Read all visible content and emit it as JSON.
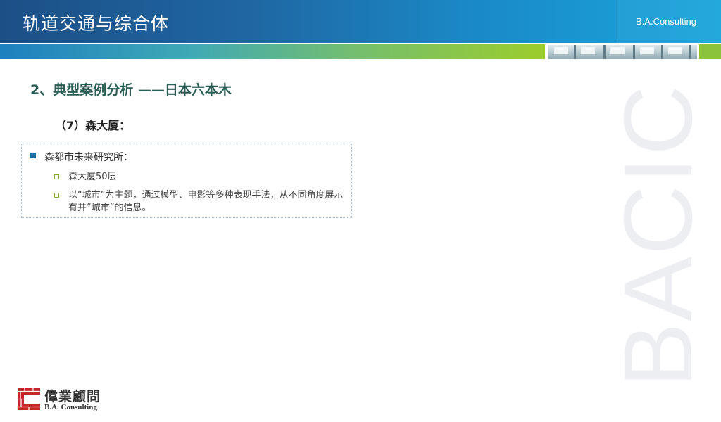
{
  "header": {
    "title": "轨道交通与综合体",
    "brand": "B.A.Consulting"
  },
  "section": {
    "title": "2、典型案例分析 ——日本六本木",
    "subtitle": "（7）森大厦："
  },
  "content": {
    "main_item": "森都市未来研究所：",
    "sub_items": [
      "森大厦50层",
      "以“城市”为主题，通过模型、电影等多种表现手法，从不同角度展示有并“城市”的信息。"
    ]
  },
  "watermark": "BACIC",
  "logo": {
    "name_cn": "偉業顧問",
    "name_en": "B.A. Consulting"
  },
  "colors": {
    "header_blue": "#1c4f86",
    "accent_green": "#8bc43a",
    "title_green": "#2a5d55",
    "bullet_blue": "#1a6fa5",
    "logo_red": "#c8262b"
  }
}
